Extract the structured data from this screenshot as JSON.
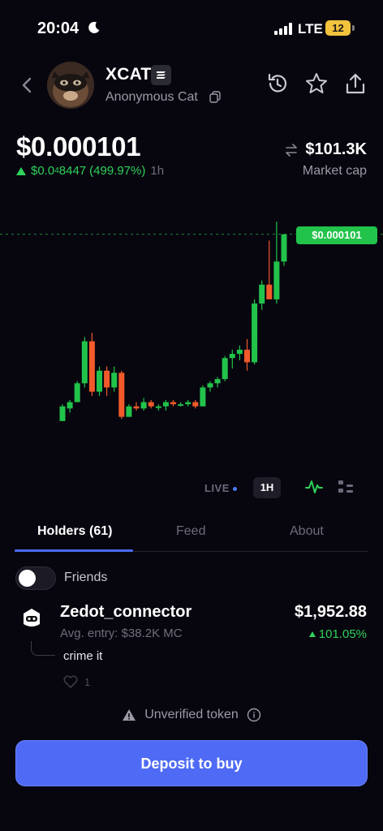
{
  "status": {
    "time": "20:04",
    "network": "LTE",
    "battery": "12"
  },
  "header": {
    "token_name": "XCAT",
    "subtitle": "Anonymous Cat",
    "icons": [
      "back-icon",
      "history-icon",
      "star-icon",
      "share-icon",
      "copy-icon",
      "chain-badge-icon"
    ]
  },
  "price": {
    "value": "$0.000101",
    "change_prefix": "$0.0",
    "change_subscript": "4",
    "change_rest": "8447",
    "change_pct": "(499.97%)",
    "period": "1h",
    "market_cap": "$101.3K",
    "market_cap_label": "Market cap"
  },
  "chart": {
    "current_label": "$0.000101",
    "live_label": "LIVE",
    "timeframe": "1H"
  },
  "chart_data": {
    "type": "candlestick",
    "candles": [
      {
        "o": 1.2e-05,
        "h": 2e-05,
        "l": 1.2e-05,
        "c": 1.9e-05
      },
      {
        "o": 1.8e-05,
        "h": 2.2e-05,
        "l": 1.6e-05,
        "c": 2.1e-05
      },
      {
        "o": 2.1e-05,
        "h": 3.1e-05,
        "l": 2.1e-05,
        "c": 3e-05
      },
      {
        "o": 3e-05,
        "h": 5.2e-05,
        "l": 2.8e-05,
        "c": 5e-05
      },
      {
        "o": 5e-05,
        "h": 5.4e-05,
        "l": 2.4e-05,
        "c": 2.6e-05
      },
      {
        "o": 2.6e-05,
        "h": 3.8e-05,
        "l": 2.4e-05,
        "c": 3.6e-05
      },
      {
        "o": 3.6e-05,
        "h": 3.8e-05,
        "l": 2.4e-05,
        "c": 2.8e-05
      },
      {
        "o": 2.8e-05,
        "h": 3.8e-05,
        "l": 2.6e-05,
        "c": 3.5e-05
      },
      {
        "o": 3.5e-05,
        "h": 3.6e-05,
        "l": 1.3e-05,
        "c": 1.4e-05
      },
      {
        "o": 1.4e-05,
        "h": 2e-05,
        "l": 1.4e-05,
        "c": 1.9e-05
      },
      {
        "o": 1.9e-05,
        "h": 2.1e-05,
        "l": 1.7e-05,
        "c": 1.8e-05
      },
      {
        "o": 1.8e-05,
        "h": 2.3e-05,
        "l": 1.7e-05,
        "c": 2.1e-05
      },
      {
        "o": 2.1e-05,
        "h": 2.2e-05,
        "l": 1.8e-05,
        "c": 1.9e-05
      },
      {
        "o": 1.9e-05,
        "h": 2e-05,
        "l": 1.7e-05,
        "c": 1.9e-05
      },
      {
        "o": 1.9e-05,
        "h": 2.2e-05,
        "l": 1.7e-05,
        "c": 2.1e-05
      },
      {
        "o": 2.1e-05,
        "h": 2.2e-05,
        "l": 1.9e-05,
        "c": 2e-05
      },
      {
        "o": 2e-05,
        "h": 2.1e-05,
        "l": 1.9e-05,
        "c": 2e-05
      },
      {
        "o": 2e-05,
        "h": 2.2e-05,
        "l": 1.9e-05,
        "c": 2.1e-05
      },
      {
        "o": 2.1e-05,
        "h": 2.2e-05,
        "l": 1.8e-05,
        "c": 1.9e-05
      },
      {
        "o": 1.9e-05,
        "h": 2.9e-05,
        "l": 1.9e-05,
        "c": 2.8e-05
      },
      {
        "o": 2.8e-05,
        "h": 3.1e-05,
        "l": 2.6e-05,
        "c": 3e-05
      },
      {
        "o": 3e-05,
        "h": 3.3e-05,
        "l": 2.8e-05,
        "c": 3.2e-05
      },
      {
        "o": 3.2e-05,
        "h": 4.3e-05,
        "l": 3.1e-05,
        "c": 4.2e-05
      },
      {
        "o": 4.2e-05,
        "h": 4.6e-05,
        "l": 3.7e-05,
        "c": 4.4e-05
      },
      {
        "o": 4.4e-05,
        "h": 4.8e-05,
        "l": 4.1e-05,
        "c": 4.6e-05
      },
      {
        "o": 4.6e-05,
        "h": 5.1e-05,
        "l": 3.6e-05,
        "c": 4e-05
      },
      {
        "o": 4e-05,
        "h": 7e-05,
        "l": 3.9e-05,
        "c": 6.8e-05
      },
      {
        "o": 6.8e-05,
        "h": 7.9e-05,
        "l": 6.5e-05,
        "c": 7.7e-05
      },
      {
        "o": 7.7e-05,
        "h": 9.8e-05,
        "l": 7.6e-05,
        "c": 7e-05
      },
      {
        "o": 7e-05,
        "h": 0.000107,
        "l": 6.8e-05,
        "c": 8.8e-05
      },
      {
        "o": 8.8e-05,
        "h": 0.000101,
        "l": 8.6e-05,
        "c": 0.000101
      }
    ],
    "current": 0.000101,
    "ylim": [
      1e-05,
      0.000109
    ],
    "grid": false
  },
  "tabs": [
    {
      "label": "Holders (61)",
      "active": true
    },
    {
      "label": "Feed",
      "active": false
    },
    {
      "label": "About",
      "active": false
    }
  ],
  "friends_label": "Friends",
  "holder": {
    "name": "Zedot_connector",
    "avg_entry": "Avg. entry: $38.2K MC",
    "value": "$1,952.88",
    "change": "101.05%",
    "comment": "crime it",
    "likes": "1"
  },
  "warning": "Unverified token",
  "deposit_label": "Deposit to buy",
  "colors": {
    "background": "#07060f",
    "up": "#22c34a",
    "down": "#f25a2b",
    "accent": "#4f6bf5"
  }
}
